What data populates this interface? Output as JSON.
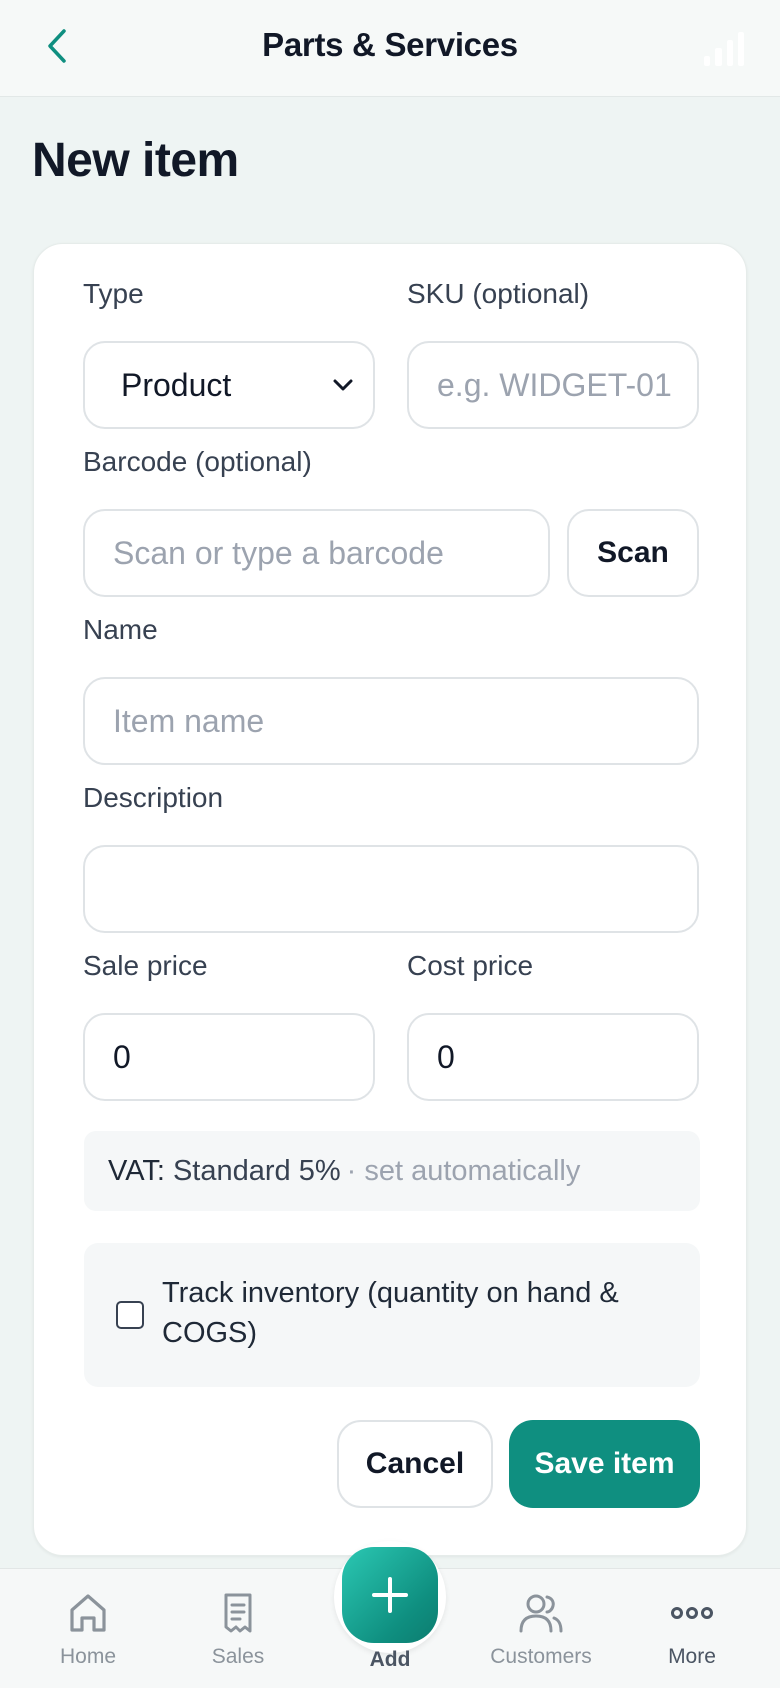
{
  "header": {
    "title": "Parts & Services",
    "back_icon": "chevron-left-icon",
    "signal_icon": "signal-icon"
  },
  "page": {
    "title": "New item"
  },
  "form": {
    "type": {
      "label": "Type",
      "value": "Product",
      "options": [
        "Product"
      ]
    },
    "sku": {
      "label": "SKU (optional)",
      "placeholder": "e.g. WIDGET-01"
    },
    "barcode": {
      "label": "Barcode (optional)",
      "placeholder": "Scan or type a barcode",
      "scan_label": "Scan"
    },
    "name": {
      "label": "Name",
      "placeholder": "Item name"
    },
    "description": {
      "label": "Description",
      "value": ""
    },
    "sale_price": {
      "label": "Sale price",
      "value": "0"
    },
    "cost_price": {
      "label": "Cost price",
      "value": "0"
    },
    "vat": {
      "key": "VAT:",
      "value": "Standard 5%",
      "note": "· set automatically"
    },
    "track_inventory": {
      "label": "Track inventory (quantity on hand & COGS)",
      "checked": false
    },
    "cancel_label": "Cancel",
    "save_label": "Save item"
  },
  "colors": {
    "accent": "#0f8f80",
    "accent_light": "#2bc8b3",
    "background": "#eef4f3",
    "text": "#111827",
    "placeholder": "#9ca3af"
  },
  "bottom_nav": {
    "items": [
      {
        "label": "Home",
        "icon": "home-icon"
      },
      {
        "label": "Sales",
        "icon": "receipt-icon"
      },
      {
        "label": "Add",
        "icon": "plus-icon"
      },
      {
        "label": "Customers",
        "icon": "users-icon"
      },
      {
        "label": "More",
        "icon": "more-horizontal-icon"
      }
    ]
  }
}
